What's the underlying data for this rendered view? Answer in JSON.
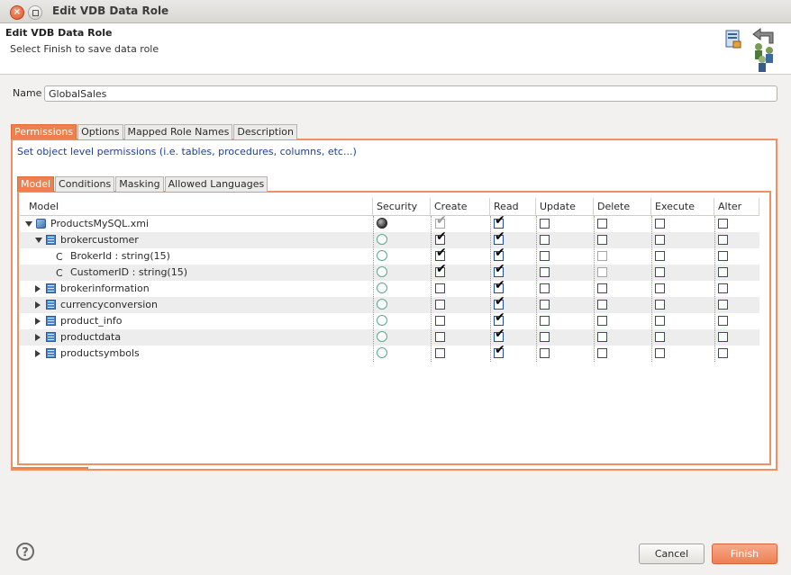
{
  "window": {
    "title": "Edit VDB Data Role"
  },
  "header": {
    "title": "Edit VDB Data Role",
    "subtitle": "Select Finish to save data role",
    "icon": "data-role-users-icon"
  },
  "name": {
    "label": "Name",
    "value": "GlobalSales"
  },
  "outer_tabs": [
    "Permissions",
    "Options",
    "Mapped Role Names",
    "Description"
  ],
  "permissions": {
    "description": "Set object level permissions (i.e. tables, procedures, columns, etc...)"
  },
  "inner_tabs": [
    "Model",
    "Conditions",
    "Masking",
    "Allowed Languages"
  ],
  "columns": [
    "Model",
    "Security",
    "Create",
    "Read",
    "Update",
    "Delete",
    "Execute",
    "Alter"
  ],
  "rows": [
    {
      "label": "ProductsMySQL.xmi",
      "level": 0,
      "type": "model",
      "expand": "open",
      "security": "filled",
      "create": "checked-disabled",
      "read": true,
      "update": false,
      "delete": false,
      "execute": false,
      "alter": false
    },
    {
      "label": "brokercustomer",
      "level": 1,
      "type": "table",
      "expand": "open",
      "security": "empty",
      "create": true,
      "read": true,
      "update": false,
      "delete": false,
      "execute": false,
      "alter": false
    },
    {
      "label": "BrokerId : string(15)",
      "level": 2,
      "type": "column",
      "expand": "none",
      "security": "empty",
      "create": true,
      "read": true,
      "update": false,
      "delete": "disabled",
      "execute": false,
      "alter": false
    },
    {
      "label": "CustomerID : string(15)",
      "level": 2,
      "type": "column",
      "expand": "none",
      "security": "empty",
      "create": true,
      "read": true,
      "update": false,
      "delete": "disabled",
      "execute": false,
      "alter": false
    },
    {
      "label": "brokerinformation",
      "level": 1,
      "type": "table",
      "expand": "closed",
      "security": "empty",
      "create": false,
      "read": true,
      "update": false,
      "delete": false,
      "execute": false,
      "alter": false
    },
    {
      "label": "currencyconversion",
      "level": 1,
      "type": "table",
      "expand": "closed",
      "security": "empty",
      "create": false,
      "read": true,
      "update": false,
      "delete": false,
      "execute": false,
      "alter": false
    },
    {
      "label": "product_info",
      "level": 1,
      "type": "table",
      "expand": "closed",
      "security": "empty",
      "create": false,
      "read": true,
      "update": false,
      "delete": false,
      "execute": false,
      "alter": false
    },
    {
      "label": "productdata",
      "level": 1,
      "type": "table",
      "expand": "closed",
      "security": "empty",
      "create": false,
      "read": true,
      "update": false,
      "delete": false,
      "execute": false,
      "alter": false
    },
    {
      "label": "productsymbols",
      "level": 1,
      "type": "table",
      "expand": "closed",
      "security": "empty",
      "create": false,
      "read": true,
      "update": false,
      "delete": false,
      "execute": false,
      "alter": false
    }
  ],
  "footer": {
    "help": "?",
    "cancel": "Cancel",
    "finish": "Finish"
  }
}
